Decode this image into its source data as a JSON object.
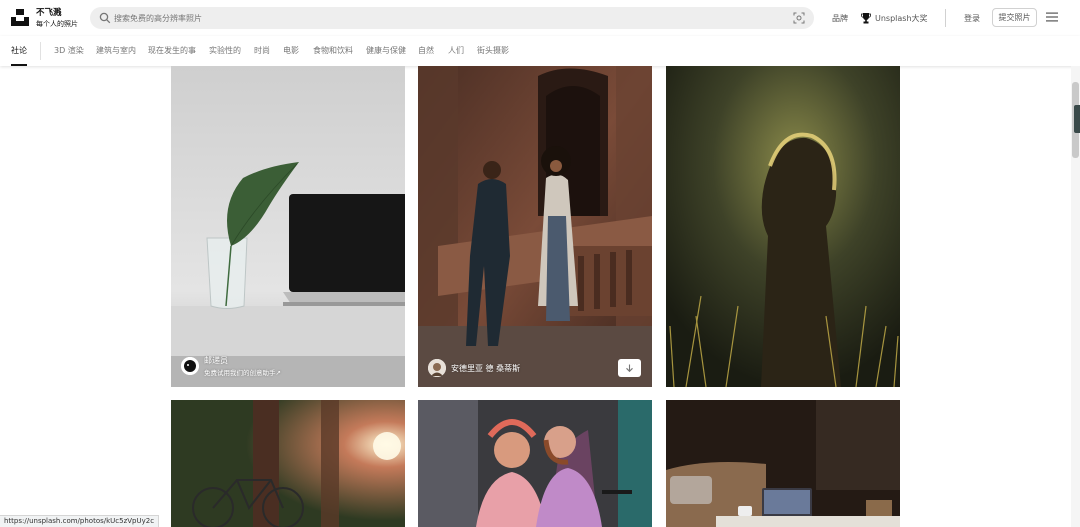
{
  "header": {
    "logo_title": "不飞溅",
    "logo_subtitle": "每个人的照片",
    "search_placeholder": "搜索免费的高分辨率照片",
    "brand_label": "品牌",
    "award_label": "Unsplash大奖",
    "login_label": "登录",
    "submit_label": "提交照片"
  },
  "tabs": [
    {
      "label": "社论",
      "active": true
    },
    {
      "label": "3D 渲染"
    },
    {
      "label": "建筑与室内"
    },
    {
      "label": "现在发生的事"
    },
    {
      "label": "实验性的"
    },
    {
      "label": "时尚"
    },
    {
      "label": "电影"
    },
    {
      "label": "食物和饮料"
    },
    {
      "label": "健康与保健"
    },
    {
      "label": "自然"
    },
    {
      "label": "人们"
    },
    {
      "label": "街头摄影"
    }
  ],
  "photos": {
    "p1": {
      "author": "邮递员",
      "subtitle": "免费试用我们的创意助手↗"
    },
    "p2": {
      "author": "安德里亚 德 桑蒂斯"
    }
  },
  "status_url": "https://unsplash.com/photos/kUc5zVpUy2c",
  "colors": {
    "accent": "#111111",
    "search_bg": "#eeeeee",
    "muted_text": "#767676"
  }
}
